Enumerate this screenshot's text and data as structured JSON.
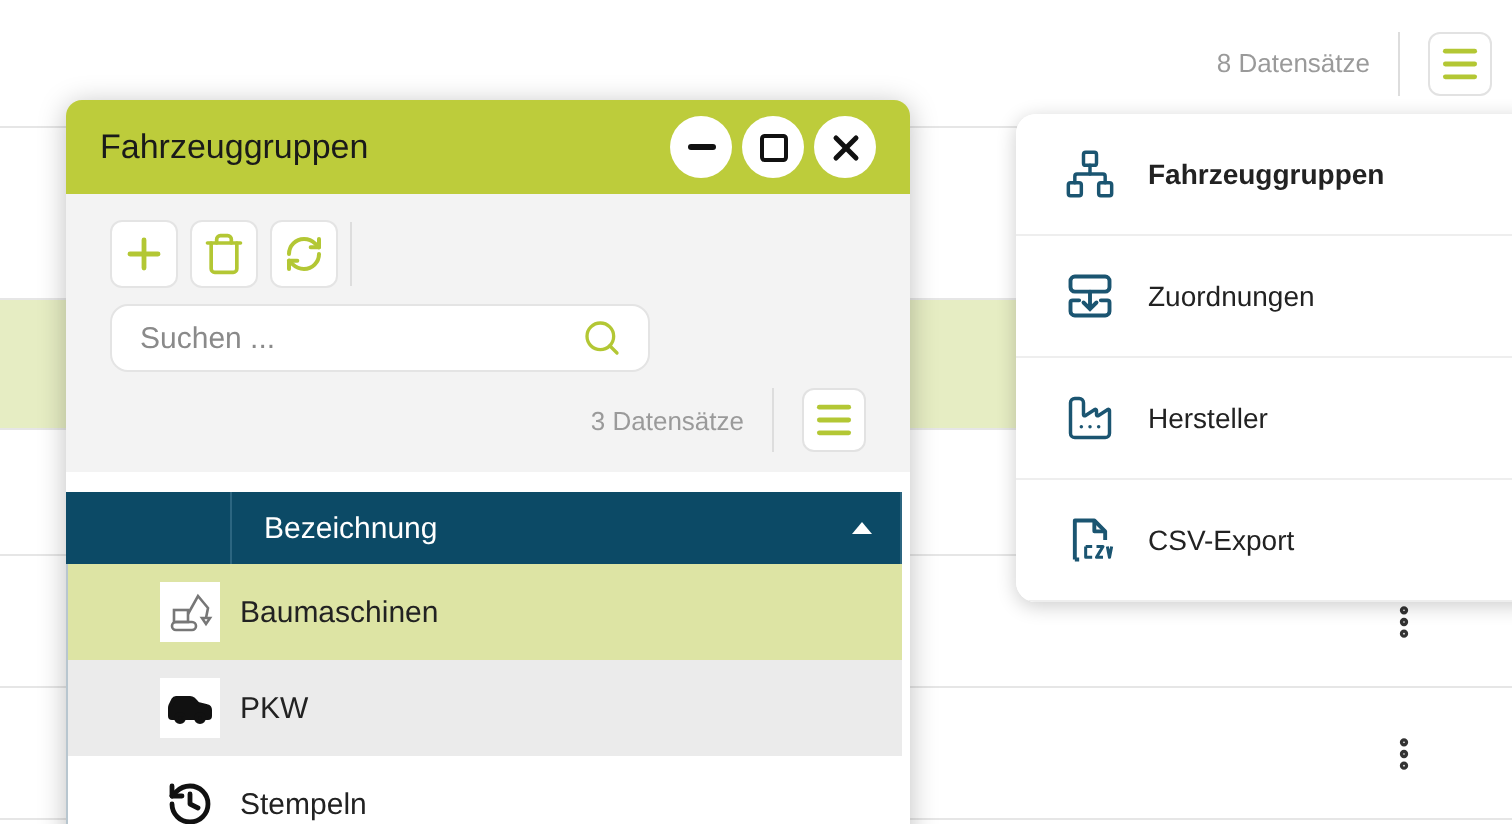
{
  "page": {
    "record_count": "8 Datensätze"
  },
  "background_rows": [
    {
      "selected": false
    },
    {
      "selected": true
    },
    {
      "selected": false
    },
    {
      "selected": false,
      "actions_visible": true
    },
    {
      "selected": false,
      "actions_visible": true
    }
  ],
  "window": {
    "title": "Fahrzeuggruppen",
    "search": {
      "placeholder": "Suchen ..."
    },
    "record_count": "3 Datensätze",
    "table": {
      "columns": [
        "Bezeichnung"
      ],
      "sorted_ascending": true,
      "rows": [
        {
          "name": "Baumaschinen",
          "selected": true,
          "hovered": false
        },
        {
          "name": "PKW",
          "selected": false,
          "hovered": true
        },
        {
          "name": "Stempeln",
          "selected": false,
          "hovered": false
        }
      ]
    }
  },
  "menu": {
    "items": [
      {
        "label": "Fahrzeuggruppen",
        "selected": true
      },
      {
        "label": "Zuordnungen",
        "selected": false
      },
      {
        "label": "Hersteller",
        "selected": false
      },
      {
        "label": "CSV-Export",
        "selected": false
      }
    ]
  }
}
